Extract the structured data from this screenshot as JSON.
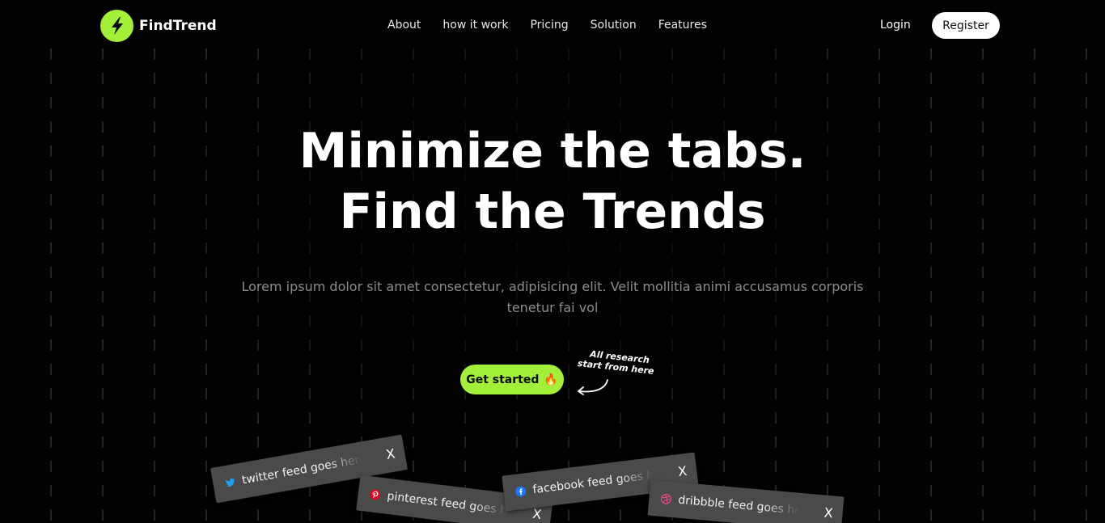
{
  "brand": {
    "name": "FindTrend",
    "accent": "#a3f03a",
    "logo_icon": "lightning-bolt-icon"
  },
  "nav": {
    "links": [
      "About",
      "how it work",
      "Pricing",
      "Solution",
      "Features"
    ],
    "login": "Login",
    "register": "Register"
  },
  "hero": {
    "line1": "Minimize the tabs.",
    "line2": "Find the Trends",
    "subtitle": "Lorem ipsum dolor sit amet consectetur, adipisicing elit. Velit mollitia animi accusamus corporis tenetur fai vol",
    "cta_label": "Get started",
    "cta_icon": "🔥",
    "note_line1": "All research",
    "note_line2": "start from here"
  },
  "feeds": [
    {
      "label": "twitter feed goes here",
      "icon": "twitter-icon",
      "color": "#1da1f2",
      "close": "X"
    },
    {
      "label": "pinterest feed goes here",
      "icon": "pinterest-icon",
      "color": "#e60023",
      "close": "X"
    },
    {
      "label": "facebook feed goes here",
      "icon": "facebook-icon",
      "color": "#1877f2",
      "close": "X"
    },
    {
      "label": "dribbble feed goes here",
      "icon": "dribbble-icon",
      "color": "#ea4c89",
      "close": "X"
    }
  ]
}
